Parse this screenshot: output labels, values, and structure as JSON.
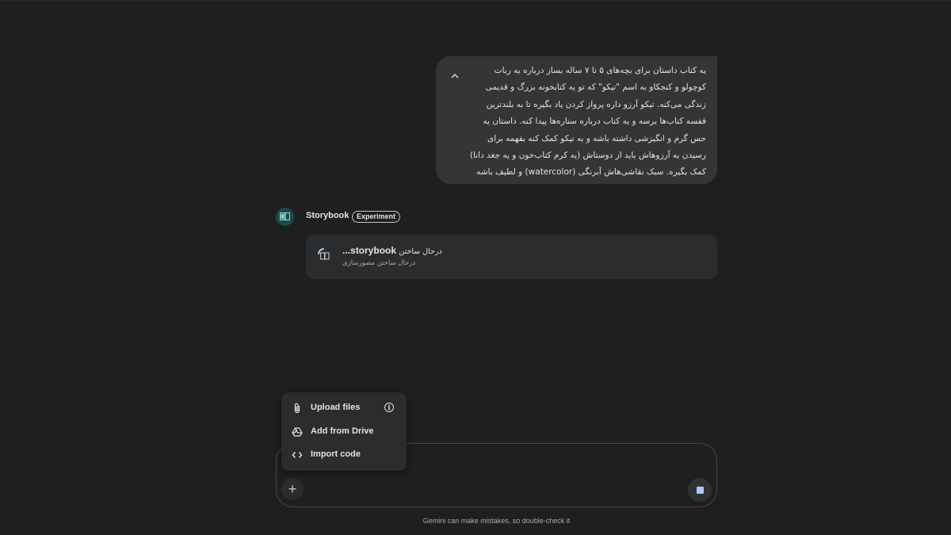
{
  "user_message": {
    "text": "یه کتاب داستان برای بچه‌های ۵ تا ۷ ساله بساز درباره یه ربات کوچولو و کنجکاو به اسم \"تیکو\" که تو یه کتابخونه بزرگ و قدیمی زندگی می‌کنه. تیکو آرزو داره پرواز کردن یاد بگیره تا به بلندترین قفسه کتاب‌ها برسه و یه کتاب درباره ستاره‌ها پیدا کنه. داستان یه حس گرم و انگیزشی داشته باشه و به تیکو کمک کنه بفهمه برای رسیدن به آرزوهاش باید از دوستاش (یه کرم کتاب‌خون و یه جغد دانا) کمک بگیره. سبک نقاشی‌هاش آبرنگی (watercolor) و لطیف باشه"
  },
  "response": {
    "bot_name": "Storybook",
    "badge": "Experiment",
    "progress_card": {
      "title_en": "storybook...",
      "title_fa": "درحال ساختن",
      "subtitle": "درحال ساختن مصورسازی"
    }
  },
  "attach_menu": {
    "items": [
      {
        "label": "Upload files",
        "icon": "paperclip-icon"
      },
      {
        "label": "Add from Drive",
        "icon": "drive-icon"
      },
      {
        "label": "Import code",
        "icon": "code-icon"
      }
    ],
    "info_glyph": "i"
  },
  "input": {
    "plus_glyph": "+"
  },
  "disclaimer": "Gemini can make mistakes, so double-check it",
  "colors": {
    "background": "#1f1f1f",
    "bubble": "#333537",
    "card": "#2b2c2e",
    "accent_blue": "#a8c7fa",
    "avatar_bg": "#1a4a48"
  }
}
